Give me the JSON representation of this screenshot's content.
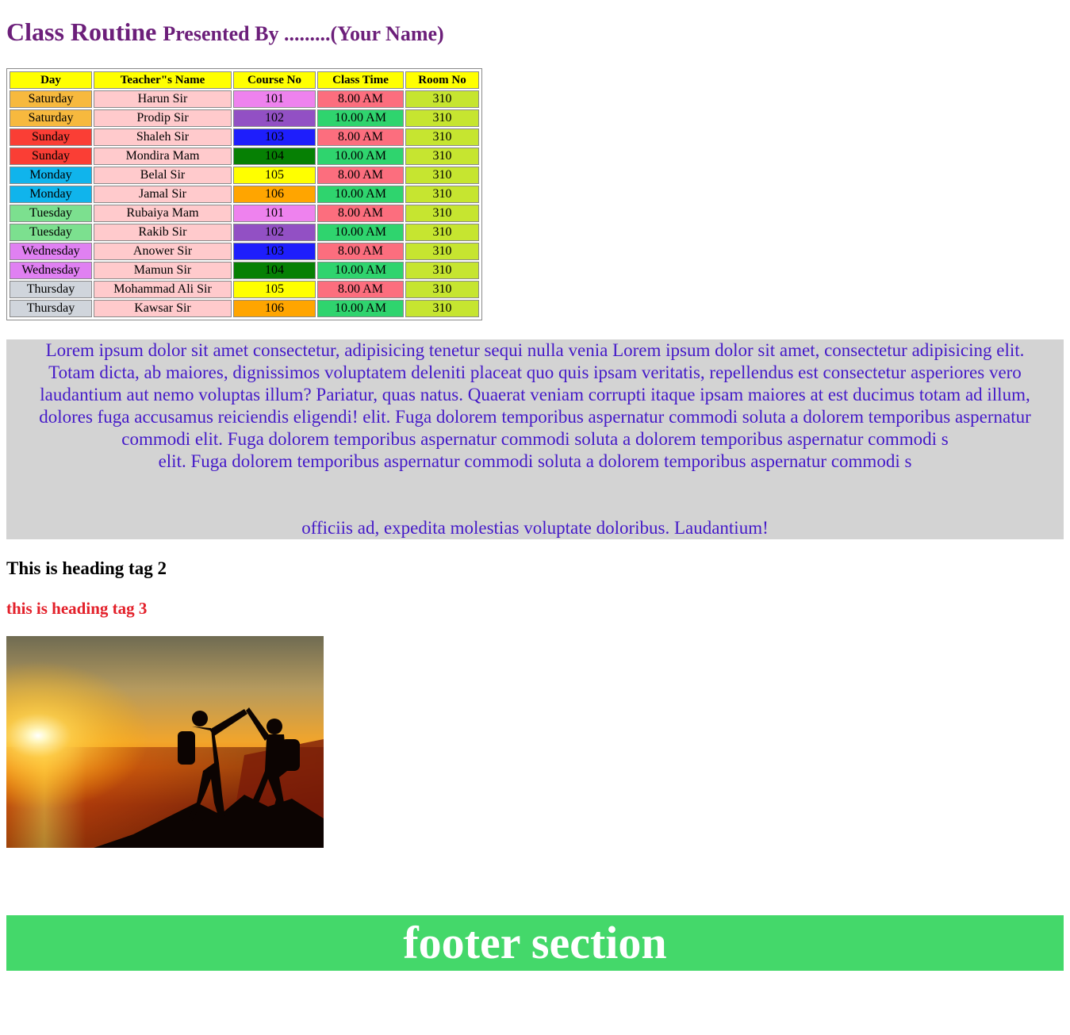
{
  "header": {
    "title": "Class Routine",
    "presenter": "Presented By .........(Your Name)"
  },
  "routine": {
    "headers": [
      "Day",
      "Teacher\"s Name",
      "Course No",
      "Class Time",
      "Room No"
    ],
    "rows": [
      {
        "day": "Saturday",
        "teacher": "Harun Sir",
        "course": "101",
        "time": "8.00 AM",
        "room": "310"
      },
      {
        "day": "Saturday",
        "teacher": "Prodip Sir",
        "course": "102",
        "time": "10.00 AM",
        "room": "310"
      },
      {
        "day": "Sunday",
        "teacher": "Shaleh Sir",
        "course": "103",
        "time": "8.00 AM",
        "room": "310"
      },
      {
        "day": "Sunday",
        "teacher": "Mondira Mam",
        "course": "104",
        "time": "10.00 AM",
        "room": "310"
      },
      {
        "day": "Monday",
        "teacher": "Belal Sir",
        "course": "105",
        "time": "8.00 AM",
        "room": "310"
      },
      {
        "day": "Monday",
        "teacher": "Jamal Sir",
        "course": "106",
        "time": "10.00 AM",
        "room": "310"
      },
      {
        "day": "Tuesday",
        "teacher": "Rubaiya Mam",
        "course": "101",
        "time": "8.00 AM",
        "room": "310"
      },
      {
        "day": "Tuesday",
        "teacher": "Rakib Sir",
        "course": "102",
        "time": "10.00 AM",
        "room": "310"
      },
      {
        "day": "Wednesday",
        "teacher": "Anower Sir",
        "course": "103",
        "time": "8.00 AM",
        "room": "310"
      },
      {
        "day": "Wednesday",
        "teacher": "Mamun Sir",
        "course": "104",
        "time": "10.00 AM",
        "room": "310"
      },
      {
        "day": "Thursday",
        "teacher": "Mohammad Ali Sir",
        "course": "105",
        "time": "8.00 AM",
        "room": "310"
      },
      {
        "day": "Thursday",
        "teacher": "Kawsar Sir",
        "course": "106",
        "time": "10.00 AM",
        "room": "310"
      }
    ],
    "day_colors": {
      "Saturday": "#f7b93e",
      "Sunday": "#fa3e35",
      "Monday": "#10b4ec",
      "Tuesday": "#7ce08f",
      "Wednesday": "#e080f2",
      "Thursday": "#d0d5dc"
    },
    "course_colors": {
      "101": "#ee82ee",
      "102": "#9250c4",
      "103": "#1e1efc",
      "104": "#068004",
      "105": "#ffff00",
      "106": "#ffa500"
    },
    "time_colors": {
      "8.00 AM": "#fc6e7e",
      "10.00 AM": "#2fd46e"
    },
    "teacher_color": "#ffcacc",
    "room_color": "#c6e530"
  },
  "paragraph": {
    "lines": [
      "Lorem ipsum dolor sit amet consectetur, adipisicing tenetur sequi nulla venia Lorem ipsum dolor sit amet, consectetur adipisicing elit.",
      "Totam dicta, ab maiores, dignissimos voluptatem deleniti placeat quo quis ipsam veritatis, repellendus est consectetur asperiores vero",
      "laudantium aut nemo voluptas illum? Pariatur, quas natus. Quaerat veniam corrupti itaque ipsam maiores at est ducimus totam ad illum,",
      "dolores fuga accusamus reiciendis eligendi! elit. Fuga dolorem temporibus aspernatur commodi soluta a dolorem temporibus aspernatur",
      "commodi elit. Fuga dolorem temporibus aspernatur commodi soluta a dolorem temporibus aspernatur commodi s",
      "elit. Fuga dolorem temporibus aspernatur commodi soluta a dolorem temporibus aspernatur commodi s"
    ],
    "last_line": "officiis ad, expedita molestias voluptate doloribus. Laudantium!",
    "text_color": "#4419c8",
    "background": "#d3d3d3"
  },
  "headings": {
    "h2": "This is heading tag 2",
    "h3": "this is heading tag 3",
    "h3_color": "#e3202a"
  },
  "footer": {
    "text": "footer section",
    "background": "#44d86a"
  }
}
